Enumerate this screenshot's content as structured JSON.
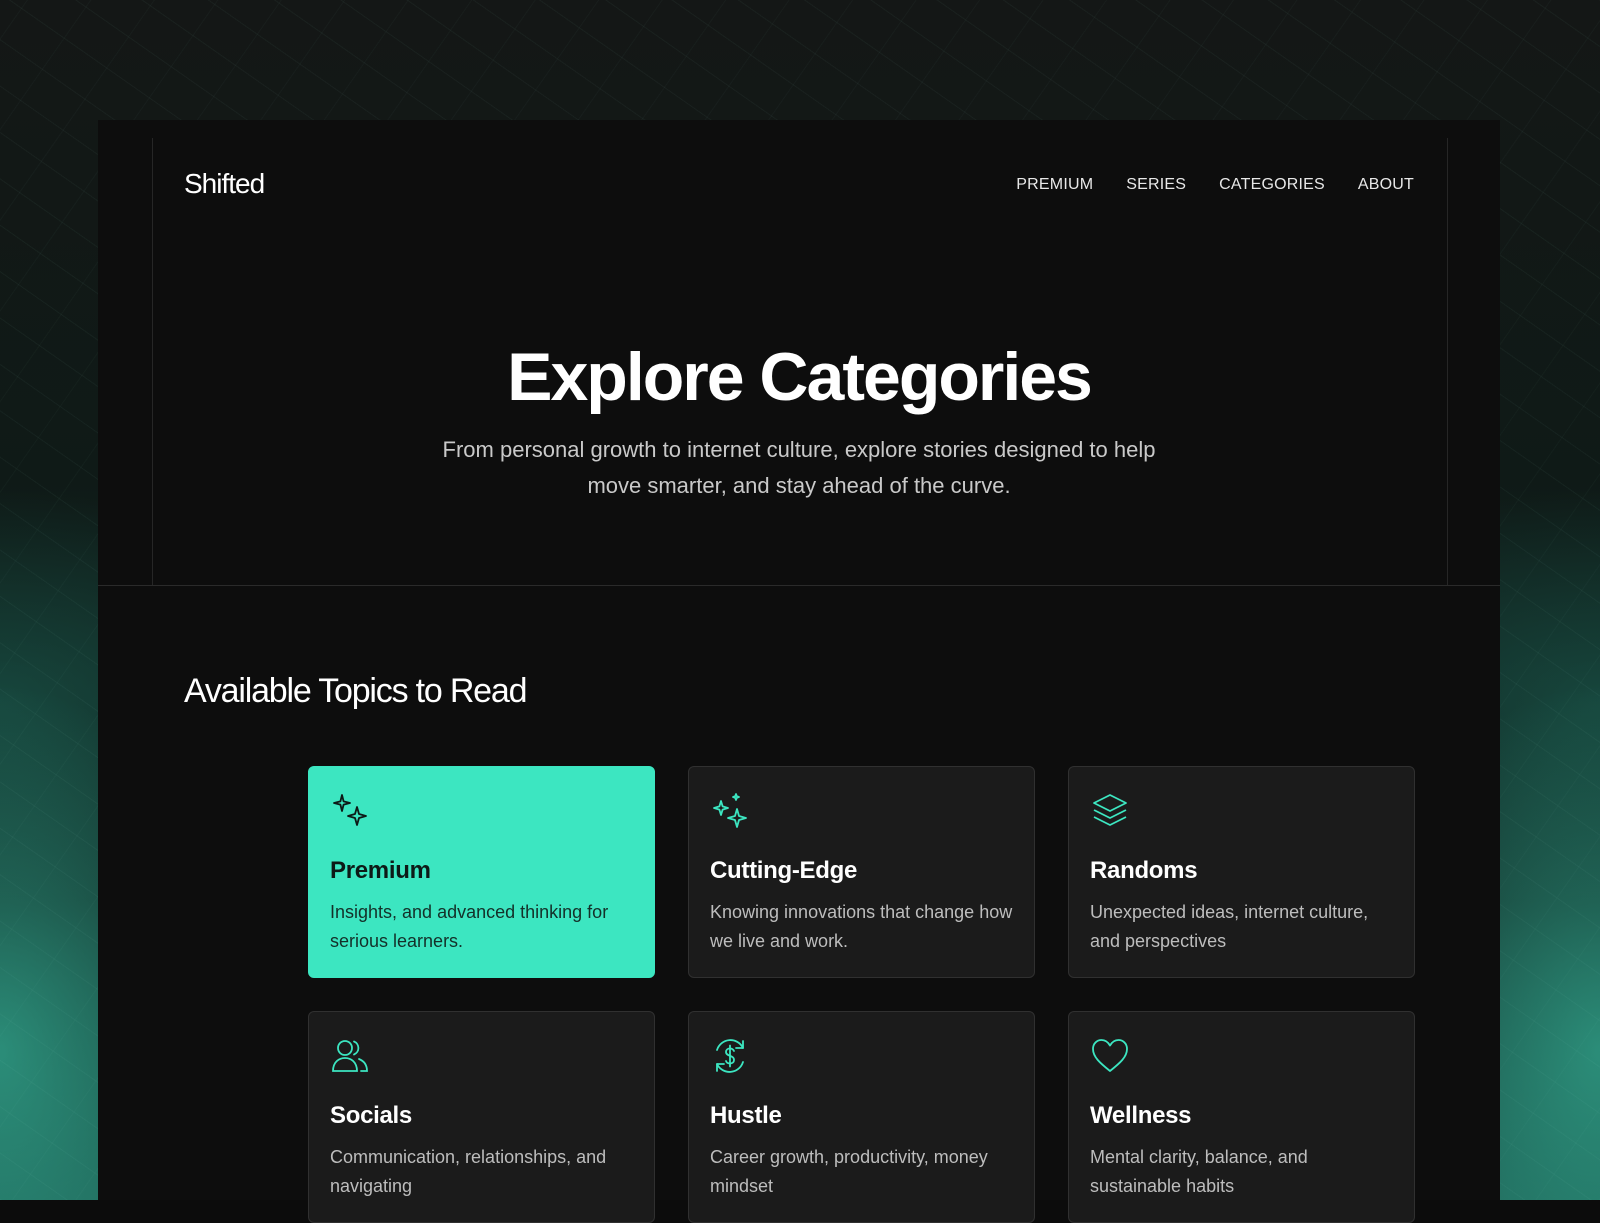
{
  "brand": {
    "logo": "Shifted"
  },
  "nav": {
    "items": [
      {
        "label": "PREMIUM"
      },
      {
        "label": "SERIES"
      },
      {
        "label": "CATEGORIES"
      },
      {
        "label": "ABOUT"
      }
    ]
  },
  "hero": {
    "title": "Explore Categories",
    "subtitle": "From personal growth to internet culture, explore stories designed to help move smarter, and stay ahead of the curve."
  },
  "topics": {
    "heading": "Available Topics to Read",
    "cards": [
      {
        "title": "Premium",
        "description": "Insights, and advanced thinking for serious learners.",
        "icon": "sparkle-icon",
        "active": true
      },
      {
        "title": "Cutting-Edge",
        "description": "Knowing innovations that change how we live and work.",
        "icon": "stars-icon",
        "active": false
      },
      {
        "title": "Randoms",
        "description": "Unexpected ideas, internet culture, and perspectives",
        "icon": "layers-icon",
        "active": false
      },
      {
        "title": "Socials",
        "description": "Communication, relationships, and navigating",
        "icon": "users-icon",
        "active": false
      },
      {
        "title": "Hustle",
        "description": "Career growth, productivity, money mindset",
        "icon": "dollar-cycle-icon",
        "active": false
      },
      {
        "title": "Wellness",
        "description": "Mental clarity, balance, and sustainable habits",
        "icon": "heart-icon",
        "active": false
      }
    ]
  },
  "colors": {
    "accent": "#3ce6c1",
    "panel_bg": "#0d0d0d",
    "card_bg": "#1b1b1b",
    "text_primary": "#ffffff",
    "text_muted": "#bdbdbd"
  }
}
